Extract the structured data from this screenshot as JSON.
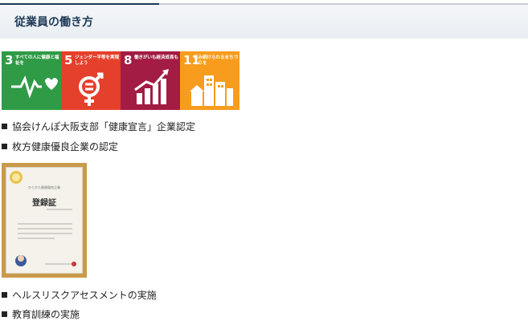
{
  "header": {
    "title": "従業員の働き方"
  },
  "sdgs": [
    {
      "number": "3",
      "label": "すべての人に健康と福祉を",
      "color": "#2f9b46",
      "icon": "heartbeat-icon"
    },
    {
      "number": "5",
      "label": "ジェンダー平等を実現しよう",
      "color": "#e5402b",
      "icon": "gender-equality-icon"
    },
    {
      "number": "8",
      "label": "働きがいも経済成長も",
      "color": "#a31c44",
      "icon": "growth-chart-icon"
    },
    {
      "number": "11",
      "label": "住み続けられるまちづくりを",
      "color": "#f79c1d",
      "icon": "city-buildings-icon"
    }
  ],
  "items": [
    "協会けんぽ大阪支部「健康宣言」企業認定",
    "枚方健康優良企業の認定",
    "ヘルスリスクアセスメントの実施",
    "教育訓練の実施"
  ],
  "certificate": {
    "heading": "登録証",
    "subheading": "ひらかた健康優良企業"
  }
}
